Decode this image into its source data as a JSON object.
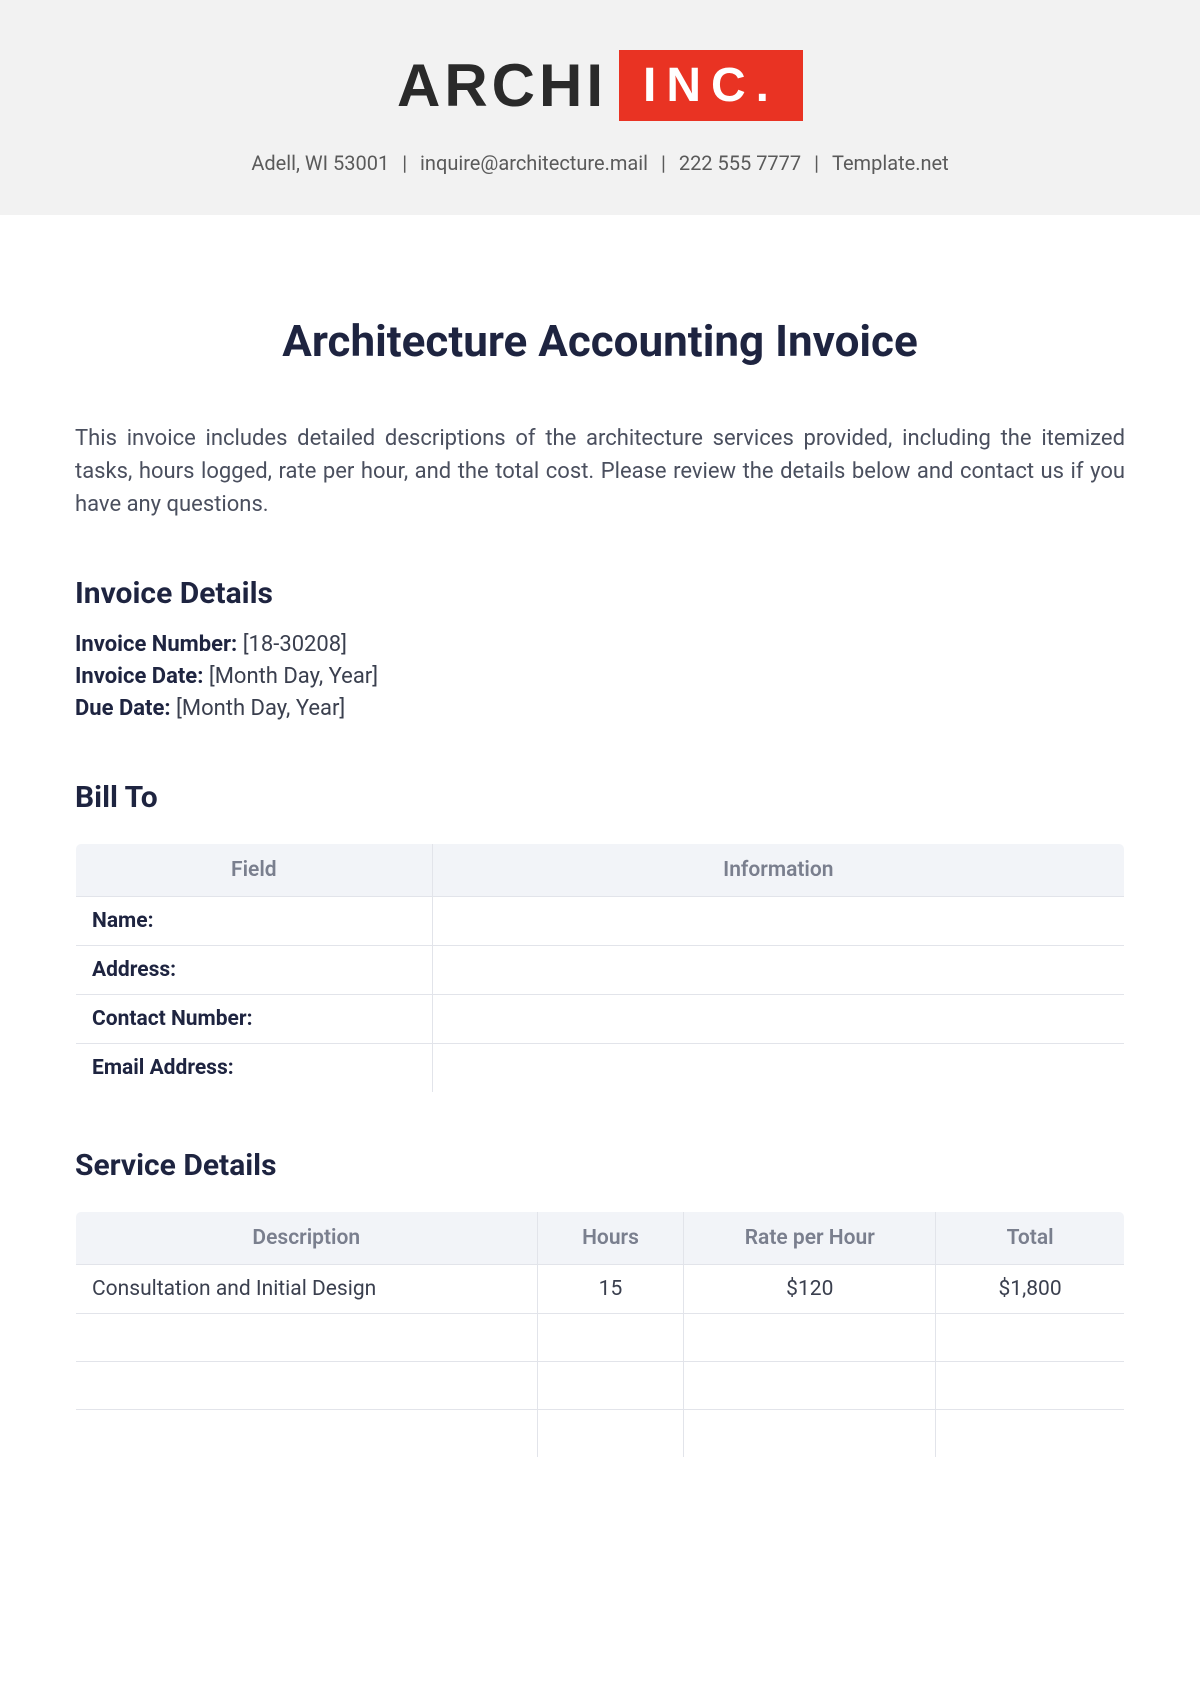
{
  "header": {
    "logo_left": "ARCHI",
    "logo_right": "INC.",
    "address": "Adell, WI 53001",
    "email": "inquire@architecture.mail",
    "phone": "222 555 7777",
    "site": "Template.net"
  },
  "title": "Architecture Accounting Invoice",
  "intro": "This invoice includes detailed descriptions of the architecture services provided, including the itemized tasks, hours logged, rate per hour, and the total cost. Please review the details below and contact us if you have any questions.",
  "invoice_details": {
    "heading": "Invoice Details",
    "number_label": "Invoice Number:",
    "number_value": "[18-30208]",
    "date_label": "Invoice Date:",
    "date_value": "[Month Day, Year]",
    "due_label": "Due Date:",
    "due_value": "[Month Day, Year]"
  },
  "bill_to": {
    "heading": "Bill To",
    "col_field": "Field",
    "col_info": "Information",
    "rows": [
      {
        "field": "Name:",
        "value": ""
      },
      {
        "field": "Address:",
        "value": ""
      },
      {
        "field": "Contact Number:",
        "value": ""
      },
      {
        "field": "Email Address:",
        "value": ""
      }
    ]
  },
  "service": {
    "heading": "Service Details",
    "col_desc": "Description",
    "col_hours": "Hours",
    "col_rate": "Rate per Hour",
    "col_total": "Total",
    "rows": [
      {
        "desc": "Consultation and Initial Design",
        "hours": "15",
        "rate": "$120",
        "total": "$1,800"
      },
      {
        "desc": "",
        "hours": "",
        "rate": "",
        "total": ""
      },
      {
        "desc": "",
        "hours": "",
        "rate": "",
        "total": ""
      },
      {
        "desc": "",
        "hours": "",
        "rate": "",
        "total": ""
      }
    ]
  }
}
